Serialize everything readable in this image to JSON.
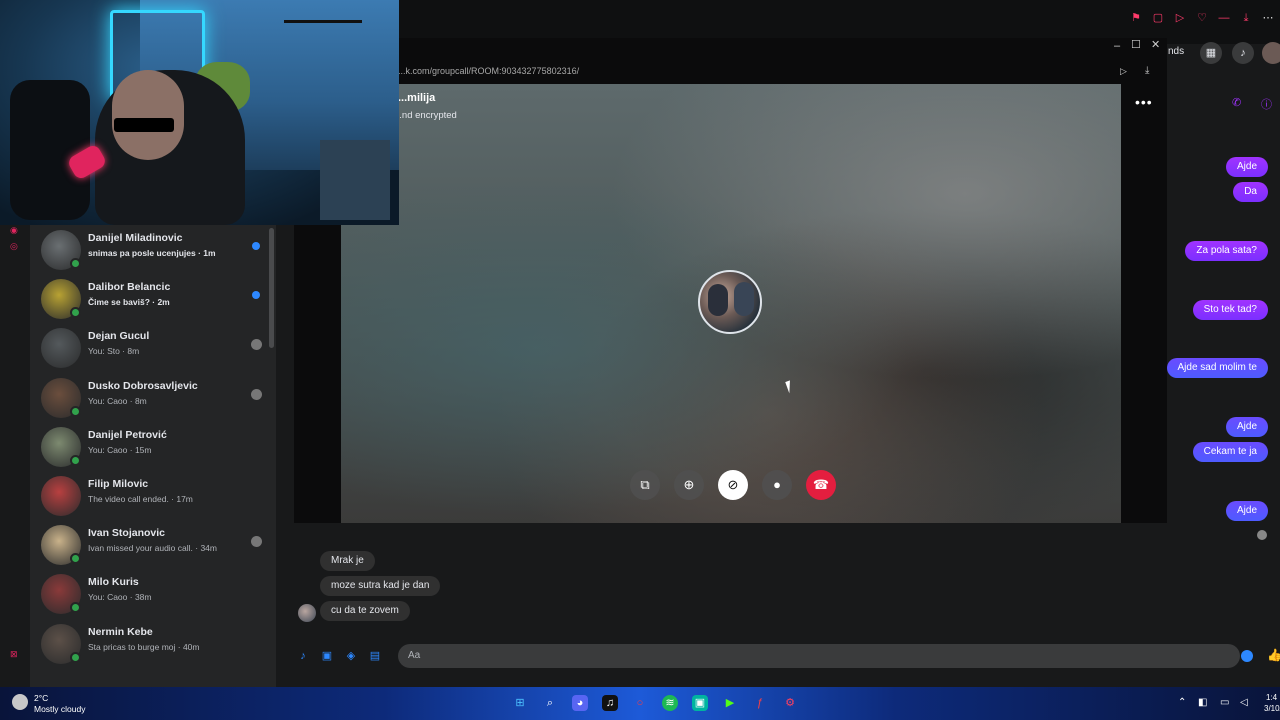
{
  "call_window": {
    "url": "...k.com/groupcall/ROOM:903432775802316/",
    "title": "...milija",
    "subtitle": "...nd encrypted",
    "controls": [
      "share-screen",
      "add-person",
      "camera-off",
      "microphone",
      "end-call"
    ]
  },
  "header": {
    "partial_label": "nds"
  },
  "chats": [
    {
      "name": "Danijel Miladinovic",
      "preview": "snimas pa posle ucenjujes · 1m",
      "unread": true,
      "online": true
    },
    {
      "name": "Dalibor Belancic",
      "preview": "Čime se baviš? · 2m",
      "unread": true,
      "online": true
    },
    {
      "name": "Dejan Gucul",
      "preview": "You: Sto · 8m",
      "unread": false,
      "online": false
    },
    {
      "name": "Dusko Dobrosavljevic",
      "preview": "You: Caoo · 8m",
      "unread": false,
      "online": true
    },
    {
      "name": "Danijel Petrović",
      "preview": "You: Caoo · 15m",
      "unread": false,
      "online": true
    },
    {
      "name": "Filip Milovic",
      "preview": "The video call ended. · 17m",
      "unread": false,
      "online": false
    },
    {
      "name": "Ivan Stojanovic",
      "preview": "Ivan missed your audio call. · 34m",
      "unread": false,
      "online": true
    },
    {
      "name": "Milo Kuris",
      "preview": "You: Caoo · 38m",
      "unread": false,
      "online": true
    },
    {
      "name": "Nermin Kebe",
      "preview": "Sta pricas to burge moj · 40m",
      "unread": false,
      "online": true
    }
  ],
  "outgoing_messages": [
    "Ajde",
    "Da",
    "Za pola sata?",
    "Sto tek tad?",
    "Ajde sad molim te",
    "Ajde",
    "Cekam te ja",
    "Ajde"
  ],
  "incoming_messages": [
    "Mrak je",
    "moze sutra kad je dan",
    "cu da te zovem"
  ],
  "composer": {
    "placeholder": "Aa"
  },
  "taskbar": {
    "weather_temp": "2°C",
    "weather_desc": "Mostly cloudy",
    "clock_time": "1:4",
    "clock_date": "3/10/"
  },
  "colors": {
    "accent_purple": "#a033ff",
    "accent_blue": "#2d88ff",
    "end_call_red": "#e41e3f",
    "online_green": "#31a24c"
  }
}
